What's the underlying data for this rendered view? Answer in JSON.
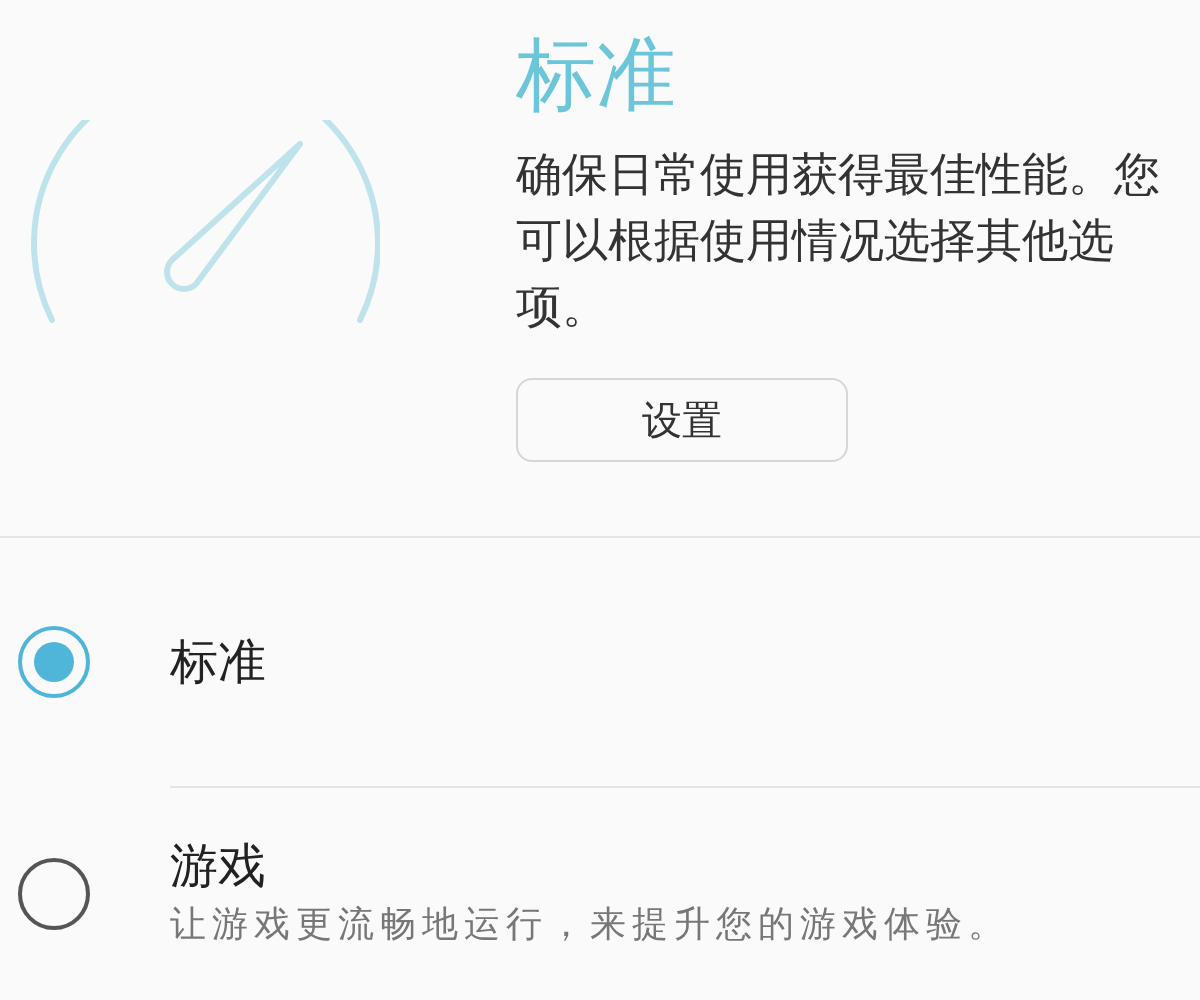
{
  "header": {
    "title": "标准",
    "description": "确保日常使用获得最佳性能。您可以根据使用情况选择其他选项。",
    "button": "设置"
  },
  "options": [
    {
      "label": "标准",
      "selected": true
    },
    {
      "label": "游戏",
      "description": "让游戏更流畅地运行，来提升您的游戏体验。",
      "selected": false
    }
  ]
}
